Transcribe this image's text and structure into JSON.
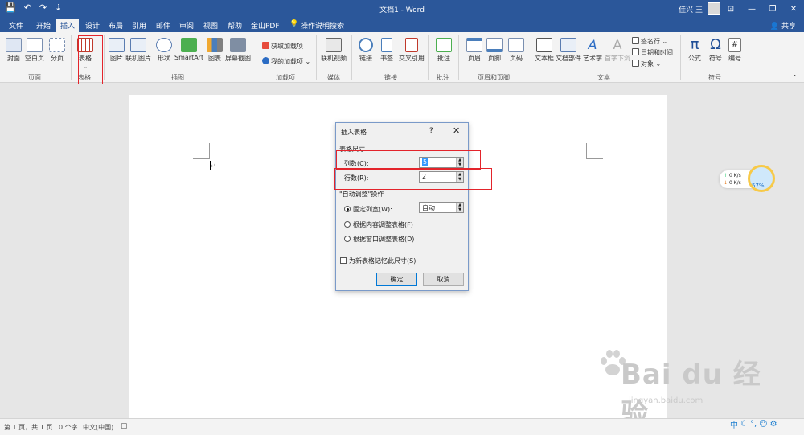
{
  "window": {
    "title": "文档1 - Word",
    "user": "佳兴 王",
    "quick_access": [
      "💾",
      "↶",
      "↷",
      "⇣"
    ],
    "controls": [
      "⊡",
      "—",
      "❐",
      "✕"
    ]
  },
  "tabs": [
    "文件",
    "开始",
    "插入",
    "设计",
    "布局",
    "引用",
    "邮件",
    "审阅",
    "视图",
    "帮助",
    "金山PDF",
    "操作说明搜索"
  ],
  "active_tab": "插入",
  "share": "共享",
  "ribbon": {
    "pages": [
      "封面",
      "空白页",
      "分页"
    ],
    "table": "表格",
    "illustrations": [
      "图片",
      "联机图片",
      "形状",
      "SmartArt",
      "图表",
      "屏幕截图"
    ],
    "addins": [
      "获取加载项",
      "我的加载项"
    ],
    "media": "联机视频",
    "links": [
      "链接",
      "书签",
      "交叉引用"
    ],
    "comment": "批注",
    "header_footer": [
      "页眉",
      "页脚",
      "页码"
    ],
    "text": [
      "文本框",
      "文档部件",
      "艺术字",
      "首字下沉"
    ],
    "text_small": [
      "签名行",
      "日期和时间",
      "对象"
    ],
    "symbols": [
      "公式",
      "符号",
      "编号"
    ],
    "symbol_glyphs": [
      "π",
      "Ω",
      "#"
    ],
    "groups": [
      "页面",
      "表格",
      "插图",
      "加载项",
      "媒体",
      "链接",
      "批注",
      "页眉和页脚",
      "文本",
      "符号"
    ]
  },
  "dialog": {
    "title": "插入表格",
    "help": "?",
    "close": "✕",
    "size_section": "表格尺寸",
    "cols_label": "列数(C):",
    "cols_value": "5",
    "rows_label": "行数(R):",
    "rows_value": "2",
    "autofit_section": "\"自动调整\"操作",
    "options": [
      "固定列宽(W):",
      "根据内容调整表格(F)",
      "根据窗口调整表格(D)"
    ],
    "fixed_width_value": "自动",
    "remember": "为新表格记忆此尺寸(S)",
    "ok": "确定",
    "cancel": "取消"
  },
  "status": {
    "page": "第 1 页，共 1 页",
    "words": "0 个字",
    "lang": "中文(中国)"
  },
  "net_widget": {
    "up": "0  K/s",
    "down": "0  K/s",
    "percent": "57%"
  },
  "watermark": {
    "brand": "Bai du 经验",
    "url": "jingyan.baidu.com"
  },
  "tray": {
    "ime": "中"
  }
}
